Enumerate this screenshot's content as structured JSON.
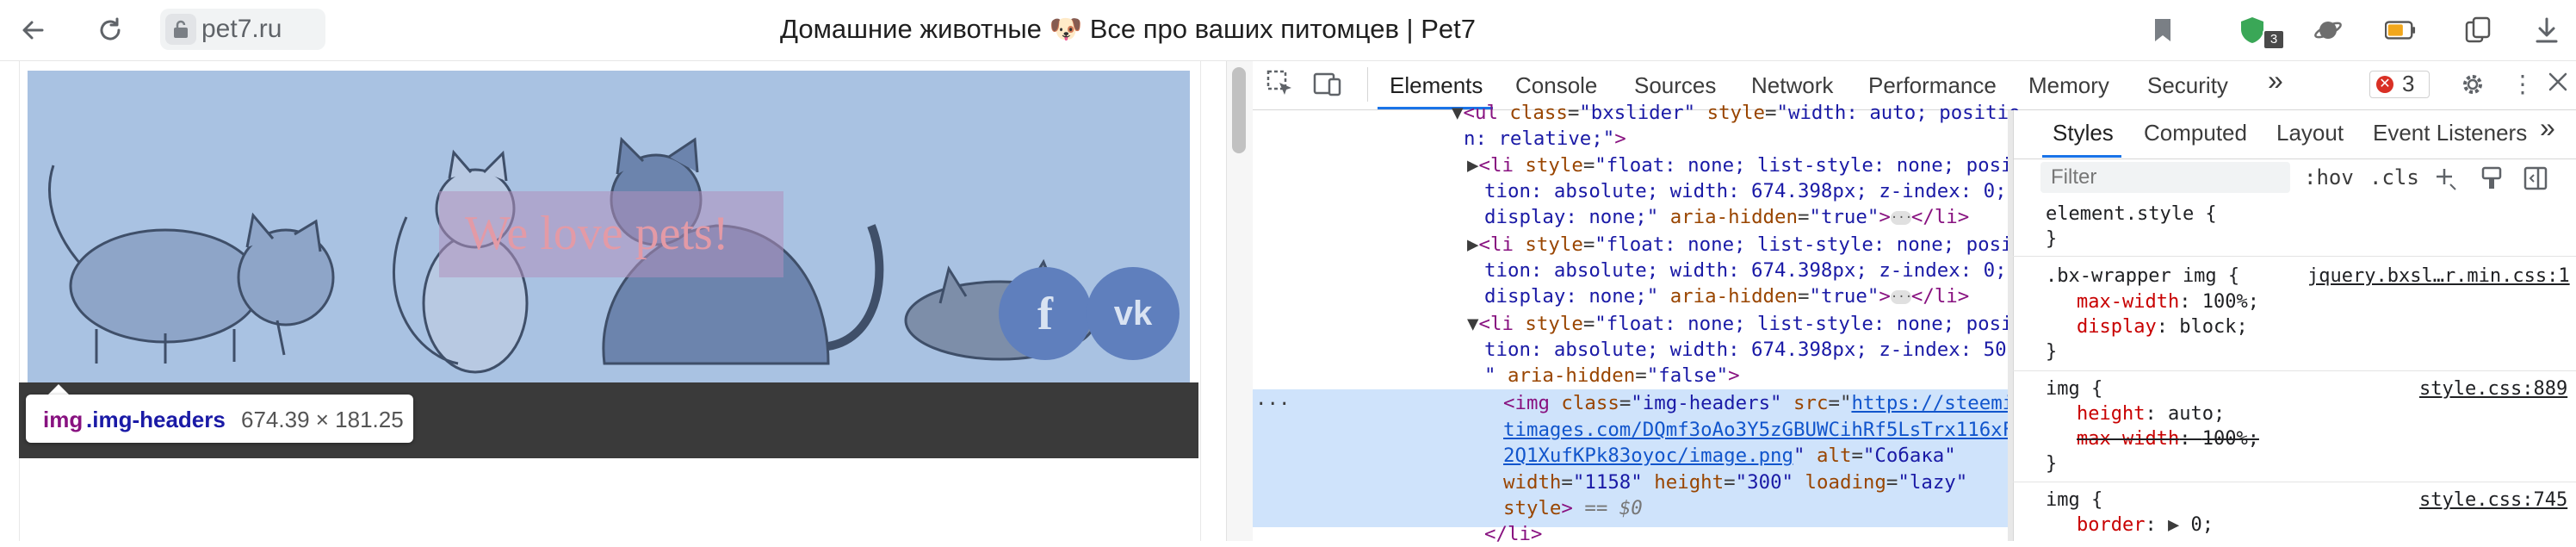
{
  "browser": {
    "url": "pet7.ru",
    "title": "Домашние животные 🐶 Все про ваших питомцев | Pet7",
    "extension_badge": "3"
  },
  "page": {
    "slider_caption": "We love pets!",
    "social": {
      "facebook": "f",
      "vk": "vk"
    },
    "tooltip": {
      "tag": "img",
      "class": ".img-headers",
      "size": "674.39 × 181.25"
    }
  },
  "devtools": {
    "tabs": [
      "Elements",
      "Console",
      "Sources",
      "Network",
      "Performance",
      "Memory",
      "Security"
    ],
    "more": "»",
    "error_count": "3",
    "elements": {
      "line1": {
        "t1": "<ul ",
        "a1": "class",
        "v1": "\"bxslider\"",
        "a2": "style",
        "v2": "\"width: auto; positio"
      },
      "line2": {
        "v": "n: relative;\"",
        "p": ">"
      },
      "li1": {
        "line1": {
          "t": "<li ",
          "a": "style",
          "v": "\"float: none; list-style: none; posi"
        },
        "line2": "tion: absolute; width: 674.398px; z-index: 0;",
        "line3": {
          "v": "display: none;\"",
          "a": "aria-hidden",
          "v2": "\"true\"",
          "end": "</li>"
        }
      },
      "li2": {
        "line1": {
          "t": "<li ",
          "a": "style",
          "v": "\"float: none; list-style: none; posi"
        },
        "line2": "tion: absolute; width: 674.398px; z-index: 0;",
        "line3": {
          "v": "display: none;\"",
          "a": "aria-hidden",
          "v2": "\"true\"",
          "end": "</li>"
        }
      },
      "li3": {
        "line1": {
          "t": "<li ",
          "a": "style",
          "v": "\"float: none; list-style: none; posi"
        },
        "line2": "tion: absolute; width: 674.398px; z-index: 50;",
        "line3": {
          "v": "\"",
          "a": "aria-hidden",
          "v2": "\"false\"",
          "p": ">"
        }
      },
      "img": {
        "line1": {
          "t": "<img ",
          "a1": "class",
          "v1": "\"img-headers\"",
          "a2": "src",
          "link": "https://steemi"
        },
        "line2": "timages.com/DQmf3oAo3Y5zGBUWCihRf5LsTrx116xF",
        "line3": {
          "link": "2Q1XufKPk83oyoc/image.png",
          "a": "alt",
          "v": "\"Собака\""
        },
        "line4": {
          "a1": "width",
          "v1": "\"1158\"",
          "a2": "height",
          "v2": "\"300\"",
          "a3": "loading",
          "v3": "\"lazy\""
        },
        "line5": {
          "a": "style",
          "p": ">",
          "eq": "== $0"
        }
      },
      "li_close": "</li>",
      "gutter_dots": "···",
      "ellipsis": "···"
    },
    "styles": {
      "tabs": [
        "Styles",
        "Computed",
        "Layout",
        "Event Listeners"
      ],
      "more": "»",
      "filter_placeholder": "Filter",
      "hov": ":hov",
      "cls": ".cls",
      "rules": [
        {
          "selector": "element.style {",
          "close": "}"
        },
        {
          "selector": ".bx-wrapper img {",
          "source": "jquery.bxsl…r.min.css:1",
          "props": [
            {
              "name": "max-width",
              "value": "100%;"
            },
            {
              "name": "display",
              "value": "block;"
            }
          ],
          "close": "}"
        },
        {
          "selector": "img {",
          "source": "style.css:889",
          "props": [
            {
              "name": "height",
              "value": "auto;"
            },
            {
              "name": "max-width",
              "value": "100%;"
            }
          ],
          "close": "}"
        },
        {
          "selector": "img {",
          "source": "style.css:745",
          "props": [
            {
              "name": "border",
              "value": "0;"
            }
          ]
        }
      ]
    }
  }
}
